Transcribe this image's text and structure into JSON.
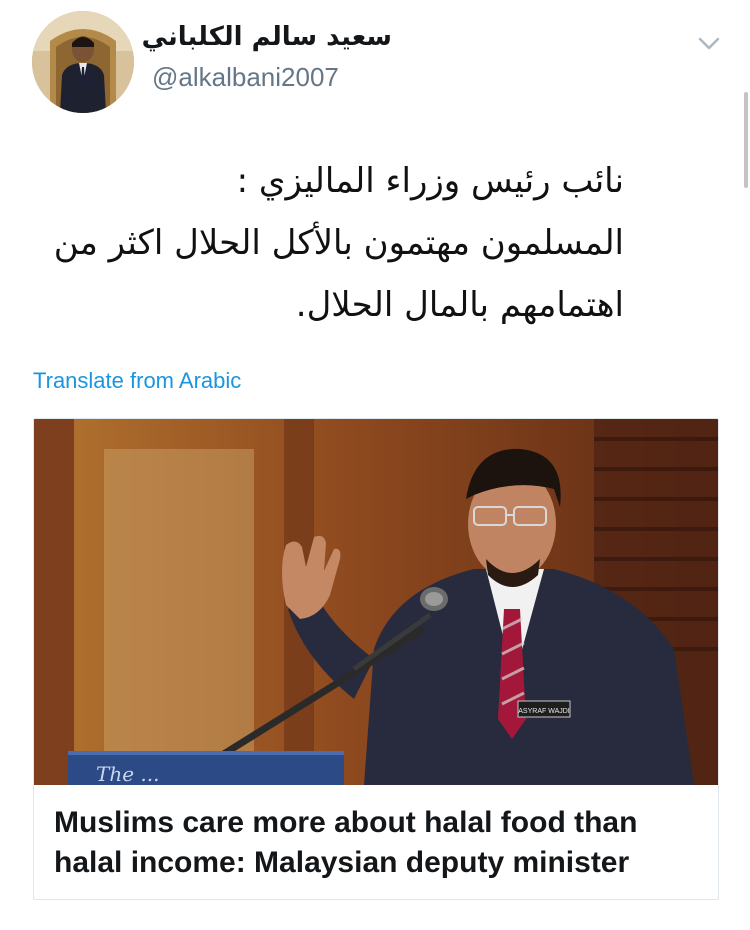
{
  "tweet": {
    "author": {
      "display_name": "سعيد سالم الكلباني",
      "handle": "@alkalbani2007",
      "avatar_icon": "user-avatar"
    },
    "menu_icon": "chevron-down-icon",
    "text_lines": [
      "نائب رئيس وزراء الماليزي :",
      "المسلمون مهتمون بالأكل الحلال اكثر من",
      "اهتمامهم بالمال الحلال."
    ],
    "translate_label": "Translate from Arabic",
    "card": {
      "title": "Muslims care more about halal food than halal income: Malaysian deputy minister",
      "image_icon": "news-photo",
      "name_tag": "ASYRAF WAJDI",
      "podium_text": "The ..."
    }
  }
}
